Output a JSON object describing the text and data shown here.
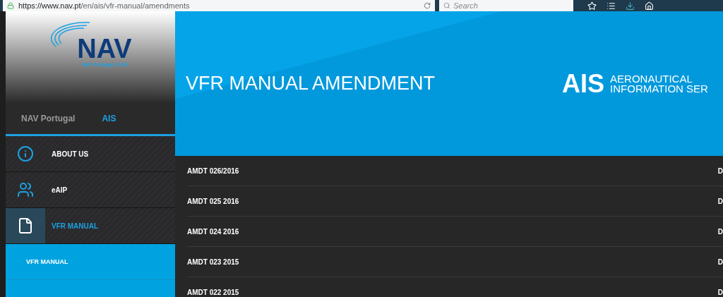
{
  "browser": {
    "url_host": "https://www.nav.pt",
    "url_path": "/en/ais/vfr-manual/amendments",
    "search_placeholder": "Search"
  },
  "logo": {
    "text": "NAV",
    "subtitle": "NAV Portugal, E.P.E."
  },
  "tabs": [
    {
      "label": "NAV Portugal",
      "selected": false
    },
    {
      "label": "AIS",
      "selected": true
    }
  ],
  "menu": [
    {
      "label": "ABOUT US",
      "kind": "info",
      "selected": false
    },
    {
      "label": "eAIP",
      "kind": "people",
      "selected": false
    },
    {
      "label": "VFR MANUAL",
      "kind": "document",
      "selected": true
    }
  ],
  "submenu": [
    {
      "label": "VFR MANUAL"
    }
  ],
  "banner": {
    "title": "VFR MANUAL AMENDMENT",
    "brand": "AIS",
    "brand_line_1": "AERONAUTICAL",
    "brand_line_2": "INFORMATION SER"
  },
  "rows": [
    {
      "column_1": "AMDT 026/2016",
      "column_2": "D"
    },
    {
      "column_1": "AMDT 025 2016",
      "column_2": "D"
    },
    {
      "column_1": "AMDT 024 2016",
      "column_2": "D"
    },
    {
      "column_1": "AMDT 023 2015",
      "column_2": "D"
    },
    {
      "column_1": "AMDT 022 2015",
      "column_2": "D"
    }
  ]
}
